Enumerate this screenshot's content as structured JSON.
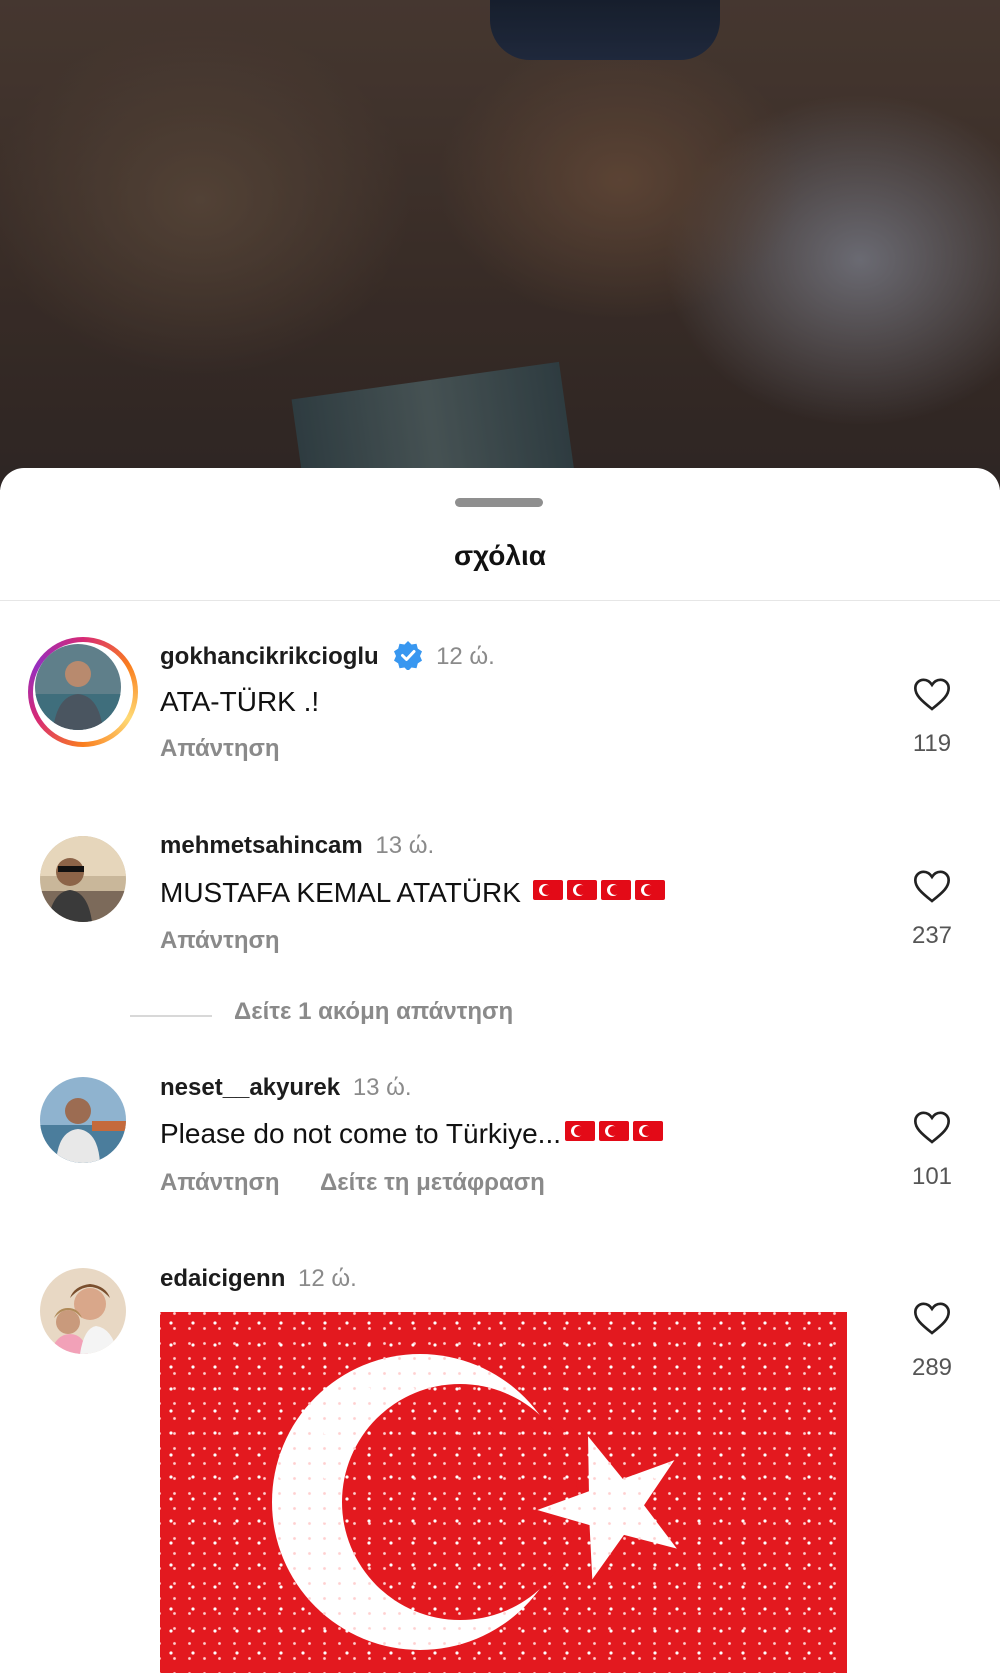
{
  "header": {
    "title": "σχόλια"
  },
  "comments": [
    {
      "username": "gokhancikrikcioglu",
      "verified": true,
      "time": "12 ώ.",
      "text": "ATA-TÜRK .!",
      "reply_label": "Απάντηση",
      "likes": "119",
      "has_story_ring": true
    },
    {
      "username": "mehmetsahincam",
      "verified": false,
      "time": "13 ώ.",
      "text": "MUSTAFA KEMAL ATATÜRK",
      "flag_count": 4,
      "reply_label": "Απάντηση",
      "likes": "237",
      "more_replies": "Δείτε 1 ακόμη απάντηση"
    },
    {
      "username": "neset__akyurek",
      "verified": false,
      "time": "13 ώ.",
      "text": "Please do not come to Türkiye...",
      "flag_count": 3,
      "reply_label": "Απάντηση",
      "translate_label": "Δείτε τη μετάφραση",
      "likes": "101"
    },
    {
      "username": "edaicigenn",
      "verified": false,
      "time": "12 ώ.",
      "text": "",
      "sticker": "turkish-flag-sparkle",
      "likes": "289"
    }
  ],
  "colors": {
    "verified_blue": "#3897f0",
    "flag_red": "#e30a17",
    "secondary_text": "#8a8a8a"
  }
}
